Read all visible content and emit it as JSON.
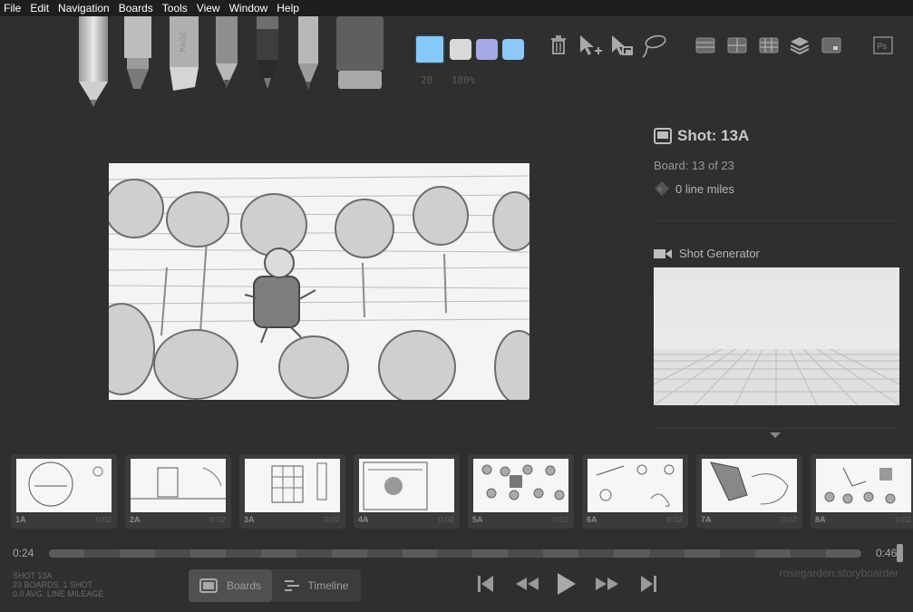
{
  "menu": [
    "File",
    "Edit",
    "Navigation",
    "Boards",
    "Tools",
    "View",
    "Window",
    "Help"
  ],
  "tools": {
    "brushes": [
      "light-pencil",
      "brush-pen",
      "pencil",
      "hard-pencil",
      "marker",
      "pen",
      "eraser"
    ],
    "swatches": [
      "#85c9fb",
      "#d9d9d9",
      "#a6a9e6",
      "#8cc8f8"
    ],
    "brush_size": "20",
    "brush_opacity": "100%"
  },
  "toolbar_icons": [
    "trash-icon",
    "move-icon",
    "scale-icon",
    "lasso-icon"
  ],
  "grid_icons": [
    "thirds-guide-icon",
    "center-guide-icon",
    "grid-guide-icon",
    "layers-icon",
    "onion-skin-icon",
    "photoshop-icon"
  ],
  "info": {
    "shot_title": "Shot: 13A",
    "board_count": "Board: 13 of 23",
    "line_miles": "0 line miles",
    "shot_generator_label": "Shot Generator"
  },
  "thumbnails": [
    {
      "num": "1A",
      "dur": "0:02"
    },
    {
      "num": "2A",
      "dur": "0:02"
    },
    {
      "num": "3A",
      "dur": "0:02"
    },
    {
      "num": "4A",
      "dur": "0:02"
    },
    {
      "num": "5A",
      "dur": "0:02"
    },
    {
      "num": "6A",
      "dur": "0:02"
    },
    {
      "num": "7A",
      "dur": "0:02"
    },
    {
      "num": "8A",
      "dur": "0:02"
    }
  ],
  "timeline": {
    "start": "0:24",
    "end": "0:46",
    "position": 1.0
  },
  "summary": {
    "line1": "SHOT 13A",
    "line2": "23 BOARDS, 1 SHOT",
    "line3": "0.0 AVG. LINE MILEAGE"
  },
  "modes": {
    "boards": "Boards",
    "timeline": "Timeline"
  },
  "brand": "rosegarden.storyboarder"
}
